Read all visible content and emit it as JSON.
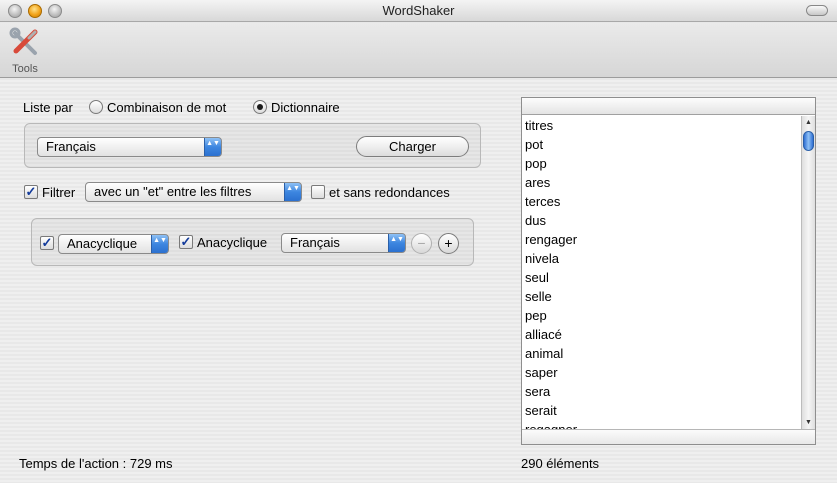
{
  "window": {
    "title": "WordShaker"
  },
  "toolbar": {
    "tools_label": "Tools"
  },
  "list_mode": {
    "label": "Liste par",
    "options": [
      {
        "label": "Combinaison de mot",
        "selected": false
      },
      {
        "label": "Dictionnaire",
        "selected": true
      }
    ]
  },
  "dictionary": {
    "language": "Français",
    "load_button": "Charger"
  },
  "filter": {
    "label": "Filtrer",
    "checked": true,
    "mode": "avec un \"et\" entre les filtres",
    "no_duplicates_label": "et sans redondances",
    "no_duplicates_checked": false
  },
  "filter_row": {
    "checked": true,
    "type": "Anacyclique",
    "sub_checked": true,
    "sub_label": "Anacyclique",
    "language": "Français",
    "remove_symbol": "−",
    "add_symbol": "+"
  },
  "results": {
    "words": [
      "titres",
      "pot",
      "pop",
      "ares",
      "terces",
      "dus",
      "rengager",
      "nivela",
      "seul",
      "selle",
      "pep",
      "alliacé",
      "animal",
      "saper",
      "sera",
      "serait",
      "regagner"
    ],
    "count_text": "290 éléments"
  },
  "status": {
    "action_time": "Temps de l'action : 729 ms"
  },
  "icons": {
    "scroll_up": "▲",
    "scroll_down": "▼",
    "popup_arrows": "▲▼",
    "check": "✓"
  }
}
